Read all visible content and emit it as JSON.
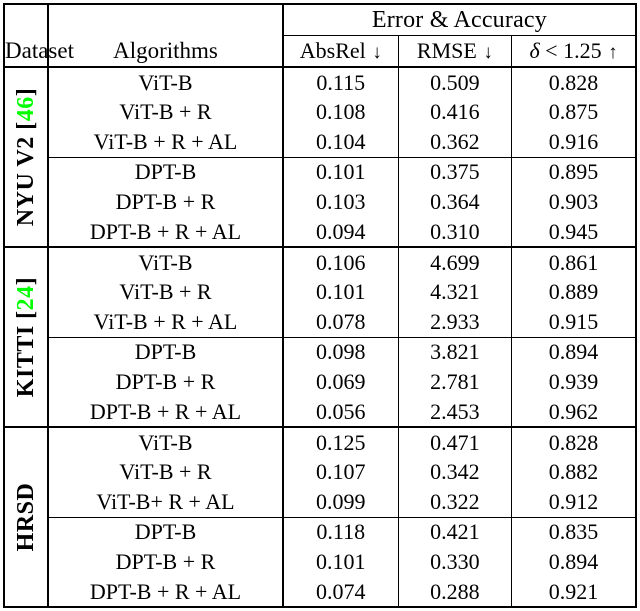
{
  "table": {
    "header": {
      "dataset_label": "Dataset",
      "algorithms_label": "Algorithms",
      "group_label": "Error & Accuracy",
      "columns": [
        {
          "key": "absrel",
          "label": "AbsRel",
          "arrow": "↓"
        },
        {
          "key": "rmse",
          "label": "RMSE",
          "arrow": "↓"
        },
        {
          "key": "delta",
          "label_delta": "δ",
          "label_rest": " < 1.25",
          "arrow": "↑"
        }
      ]
    },
    "citation_color": "#00ff00",
    "sections": [
      {
        "dataset_name": "NYU V2",
        "citation_open": "[",
        "citation_num": "46",
        "citation_close": "]",
        "groups": [
          {
            "rows": [
              {
                "algorithm": "ViT-B",
                "absrel": "0.115",
                "rmse": "0.509",
                "delta": "0.828",
                "bold": false
              },
              {
                "algorithm": "ViT-B + R",
                "absrel": "0.108",
                "rmse": "0.416",
                "delta": "0.875",
                "bold": false
              },
              {
                "algorithm": "ViT-B + R + AL",
                "absrel": "0.104",
                "rmse": "0.362",
                "delta": "0.916",
                "bold": true
              }
            ]
          },
          {
            "rows": [
              {
                "algorithm": "DPT-B",
                "absrel": "0.101",
                "rmse": "0.375",
                "delta": "0.895",
                "bold": false
              },
              {
                "algorithm": "DPT-B + R",
                "absrel": "0.103",
                "rmse": "0.364",
                "delta": "0.903",
                "bold": false
              },
              {
                "algorithm": "DPT-B + R + AL",
                "absrel": "0.094",
                "rmse": "0.310",
                "delta": "0.945",
                "bold": true
              }
            ]
          }
        ]
      },
      {
        "dataset_name": "KITTI",
        "citation_open": "[",
        "citation_num": "24",
        "citation_close": "]",
        "groups": [
          {
            "rows": [
              {
                "algorithm": "ViT-B",
                "absrel": "0.106",
                "rmse": "4.699",
                "delta": "0.861",
                "bold": false
              },
              {
                "algorithm": "ViT-B + R",
                "absrel": "0.101",
                "rmse": "4.321",
                "delta": "0.889",
                "bold": false
              },
              {
                "algorithm": "ViT-B + R + AL",
                "absrel": "0.078",
                "rmse": "2.933",
                "delta": "0.915",
                "bold": true
              }
            ]
          },
          {
            "rows": [
              {
                "algorithm": "DPT-B",
                "absrel": "0.098",
                "rmse": "3.821",
                "delta": "0.894",
                "bold": false
              },
              {
                "algorithm": "DPT-B + R",
                "absrel": "0.069",
                "rmse": "2.781",
                "delta": "0.939",
                "bold": false
              },
              {
                "algorithm": "DPT-B + R + AL",
                "absrel": "0.056",
                "rmse": "2.453",
                "delta": "0.962",
                "bold": true
              }
            ]
          }
        ]
      },
      {
        "dataset_name": "HRSD",
        "citation_open": "",
        "citation_num": "",
        "citation_close": "",
        "groups": [
          {
            "rows": [
              {
                "algorithm": "ViT-B",
                "absrel": "0.125",
                "rmse": "0.471",
                "delta": "0.828",
                "bold": false
              },
              {
                "algorithm": "ViT-B + R",
                "absrel": "0.107",
                "rmse": "0.342",
                "delta": "0.882",
                "bold": false
              },
              {
                "algorithm": "ViT-B+ R + AL",
                "absrel": "0.099",
                "rmse": "0.322",
                "delta": "0.912",
                "bold": true
              }
            ]
          },
          {
            "rows": [
              {
                "algorithm": "DPT-B",
                "absrel": "0.118",
                "rmse": "0.421",
                "delta": "0.835",
                "bold": false
              },
              {
                "algorithm": "DPT-B + R",
                "absrel": "0.101",
                "rmse": "0.330",
                "delta": "0.894",
                "bold": false
              },
              {
                "algorithm": "DPT-B + R + AL",
                "absrel": "0.074",
                "rmse": "0.288",
                "delta": "0.921",
                "bold": true
              }
            ]
          }
        ]
      }
    ]
  }
}
